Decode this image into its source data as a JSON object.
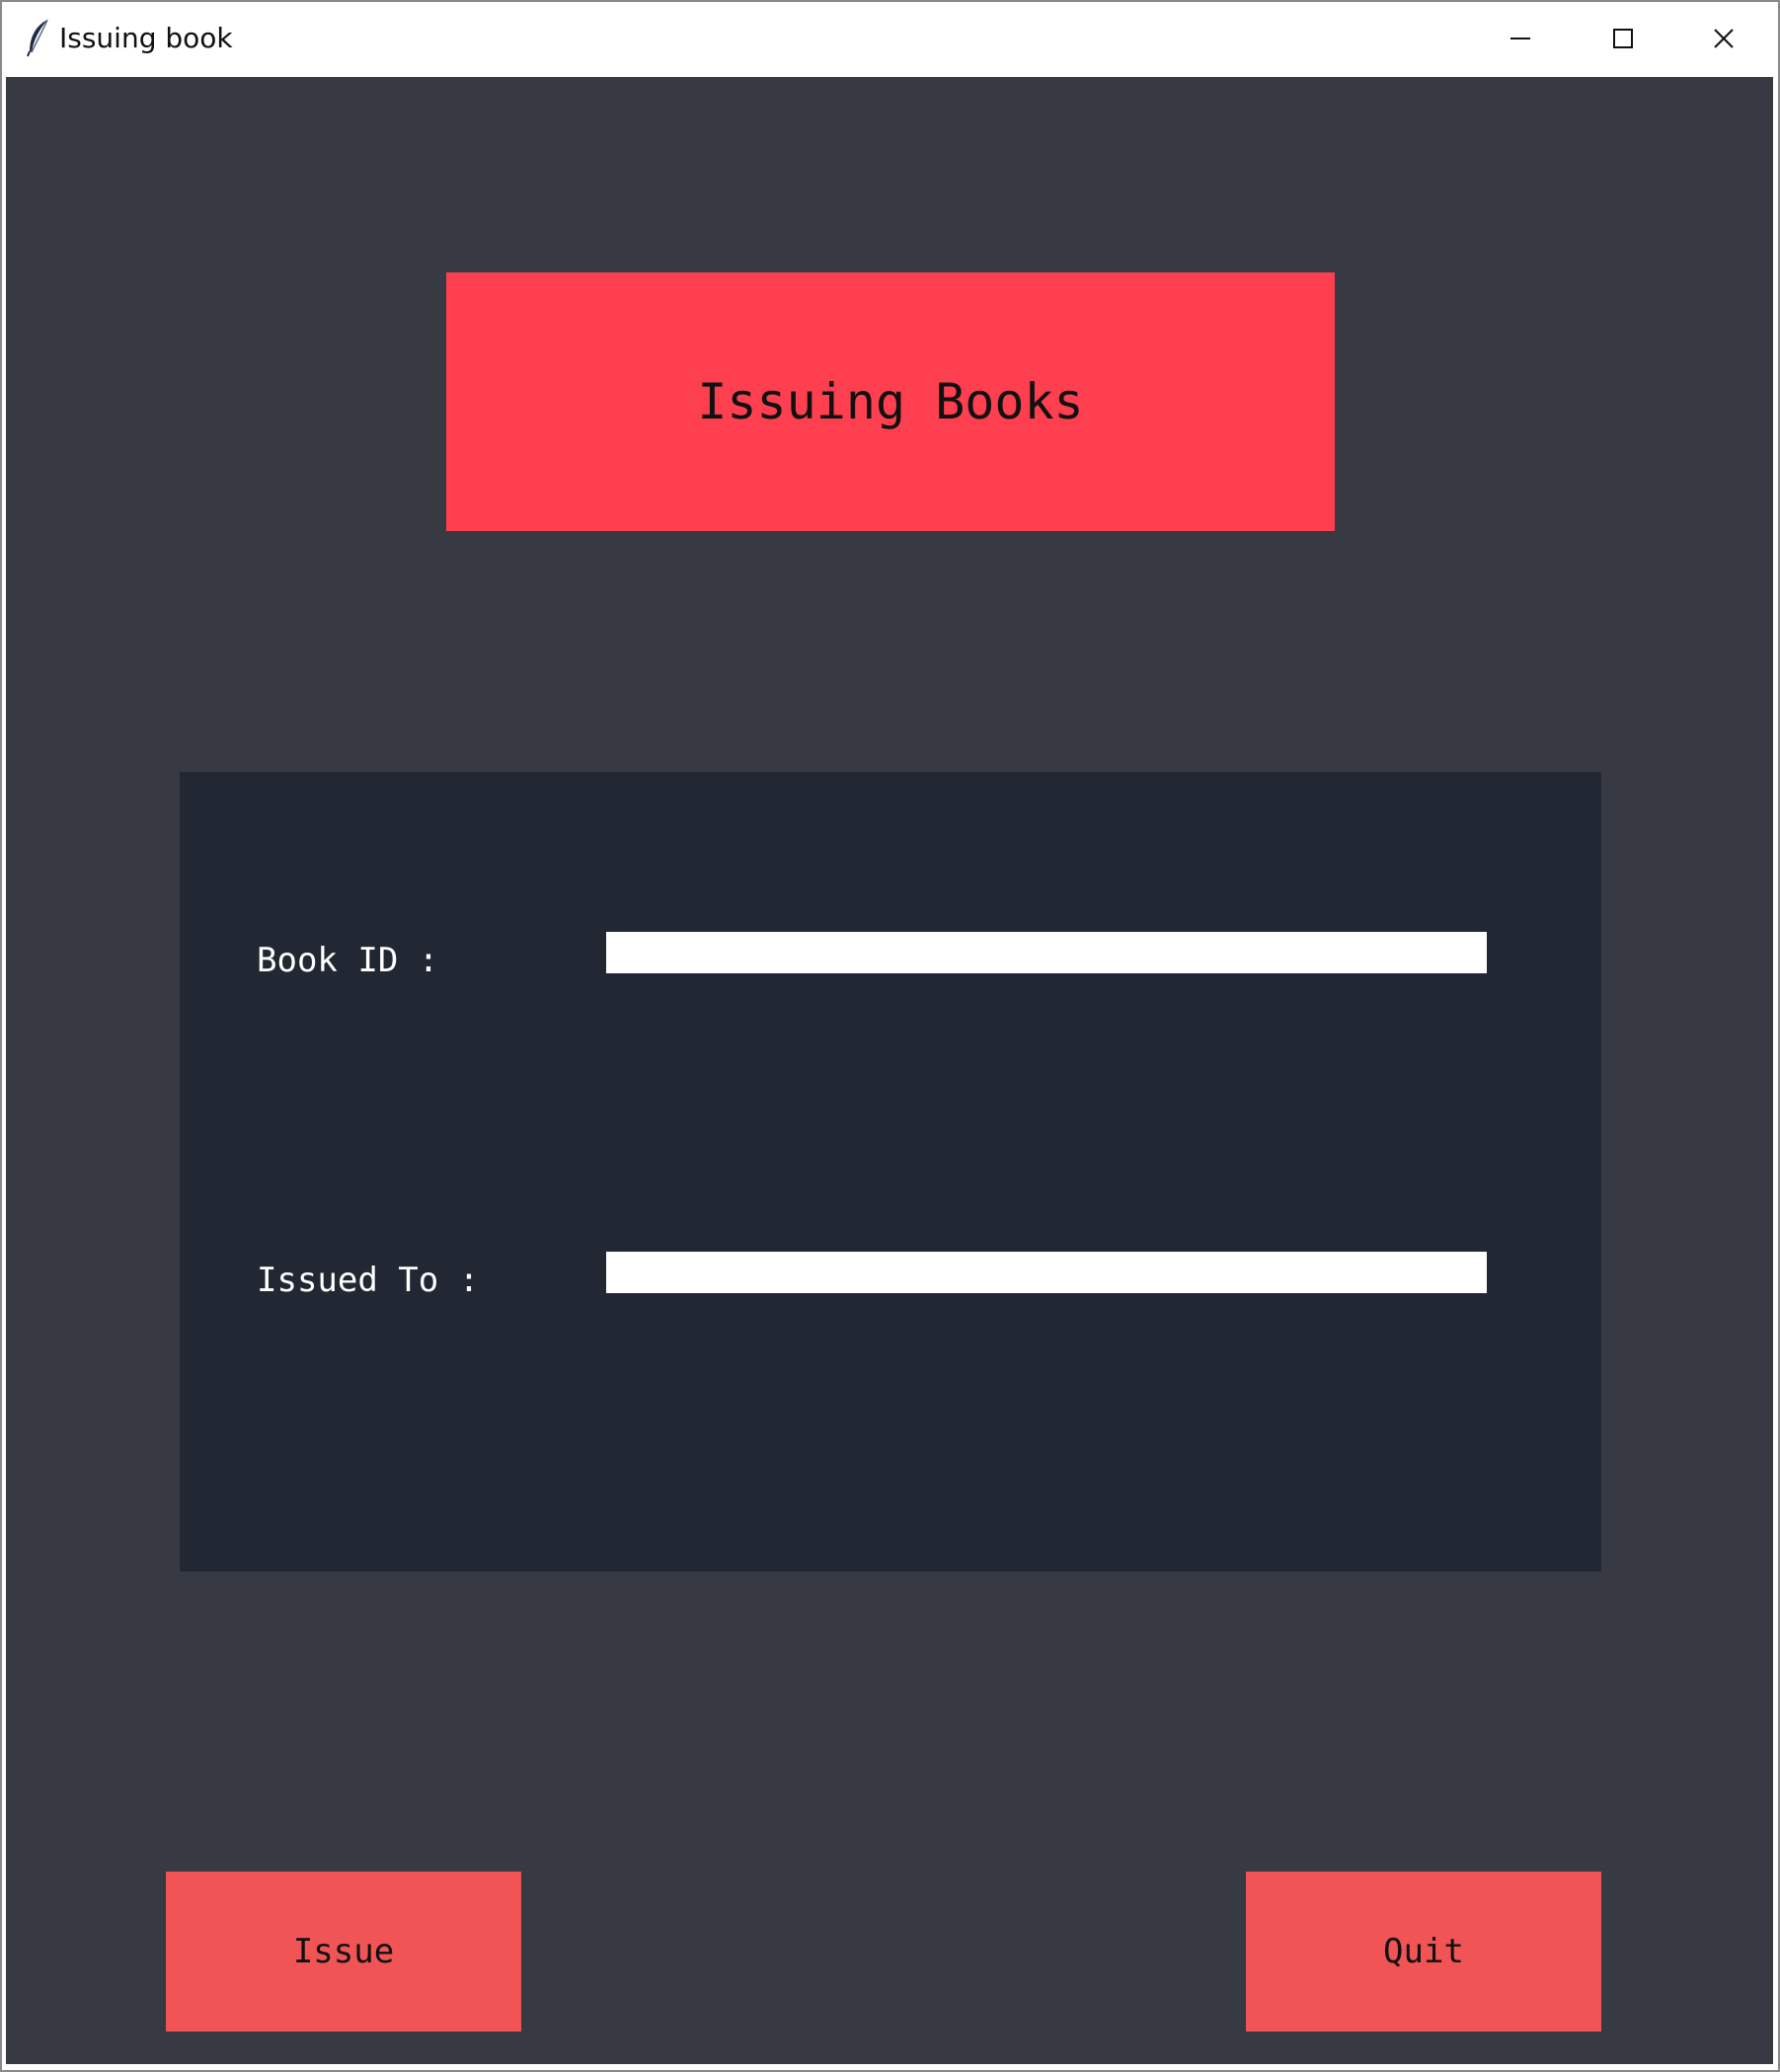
{
  "window": {
    "title": "Issuing book",
    "icon": "feather-icon",
    "controls": [
      "minimize-icon",
      "maximize-icon",
      "close-icon"
    ]
  },
  "colors": {
    "background": "#383a43",
    "panel": "#222833",
    "heading": "#fe3f4f",
    "button": "#f05455"
  },
  "heading": {
    "text": "Issuing Books"
  },
  "form": {
    "book_id_label": "Book ID :",
    "book_id_value": "",
    "issued_to_label": "Issued To :",
    "issued_to_value": ""
  },
  "actions": {
    "issue_label": "Issue",
    "quit_label": "Quit"
  }
}
